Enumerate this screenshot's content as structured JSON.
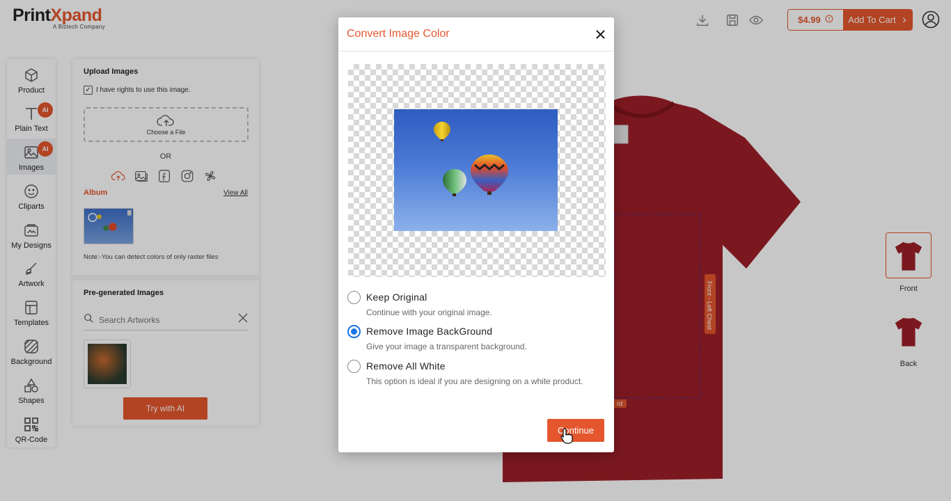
{
  "header": {
    "logo_main_a": "Print",
    "logo_main_x": "X",
    "logo_main_b": "pand",
    "logo_sub": "A Biztech Company",
    "price": "$4.99",
    "add_to_cart": "Add To Cart",
    "icons": [
      "download-icon",
      "save-icon",
      "preview-eye-icon",
      "info-icon",
      "user-icon"
    ]
  },
  "toolbar": {
    "items": [
      {
        "label": "Product",
        "icon": "cube-icon"
      },
      {
        "label": "Plain Text",
        "icon": "text-icon",
        "badge": "AI"
      },
      {
        "label": "Images",
        "icon": "image-icon",
        "badge": "AI"
      },
      {
        "label": "Cliparts",
        "icon": "smiley-icon"
      },
      {
        "label": "My Designs",
        "icon": "designs-icon"
      },
      {
        "label": "Artwork",
        "icon": "brush-icon"
      },
      {
        "label": "Templates",
        "icon": "template-icon"
      },
      {
        "label": "Background",
        "icon": "background-icon"
      },
      {
        "label": "Shapes",
        "icon": "shapes-icon"
      },
      {
        "label": "QR-Code",
        "icon": "qr-icon"
      }
    ]
  },
  "panel": {
    "upload_title": "Upload Images",
    "rights_label": "I have rights to use this image.",
    "choose_file": "Choose a File",
    "or": "OR",
    "album": "Album",
    "view_all": "View All",
    "note": "Note:-You can detect colors of only raster files",
    "pregen_title": "Pre-generated Images",
    "search_placeholder": "Search Artworks",
    "try_ai": "Try with AI"
  },
  "canvas": {
    "area_label": "Front - Left Chest",
    "tag_fragment": "rd",
    "sides": [
      {
        "label": "Front"
      },
      {
        "label": "Back"
      }
    ],
    "shirt_color": "#9e1f28"
  },
  "modal": {
    "title": "Convert Image Color",
    "options": [
      {
        "title": "Keep Original",
        "desc": "Continue with your original image.",
        "selected": false
      },
      {
        "title": "Remove Image BackGround",
        "desc": "Give your image a transparent background.",
        "selected": true
      },
      {
        "title": "Remove All White",
        "desc": "This option is ideal if you are designing on a white product.",
        "selected": false
      }
    ],
    "continue": "Continue"
  },
  "colors": {
    "accent": "#e4572e",
    "radio_selected": "#1a73e8"
  }
}
